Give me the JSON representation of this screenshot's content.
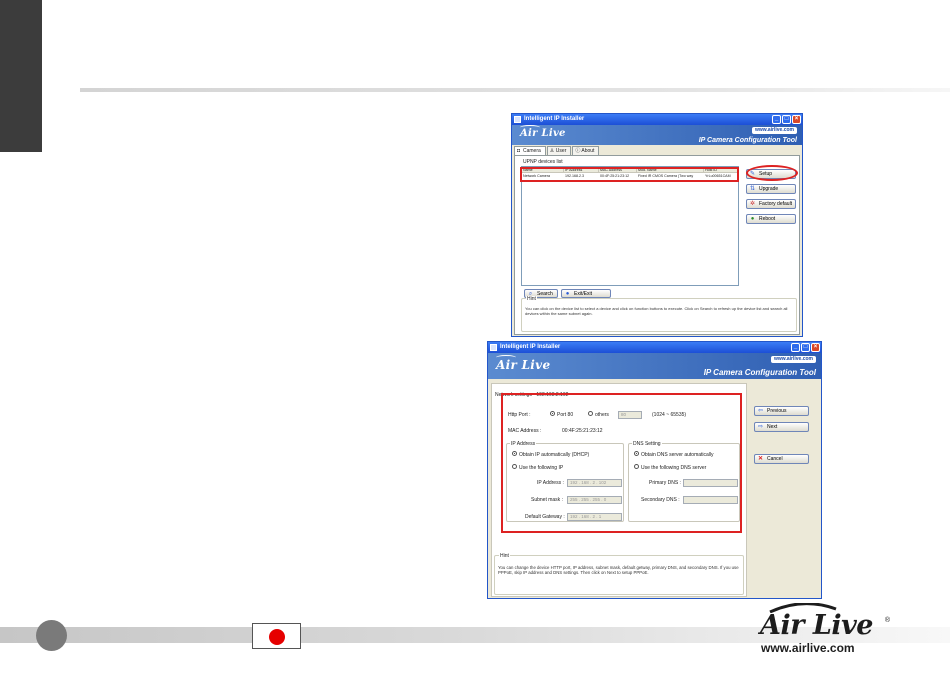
{
  "window1": {
    "title": "Intelligent IP Installer",
    "banner": {
      "logo": "Air Live",
      "url": "www.airlive.com",
      "subtitle": "IP Camera Configuration Tool"
    },
    "tabs": [
      {
        "label": "Camera",
        "icon": "camera-icon"
      },
      {
        "label": "User",
        "icon": "user-icon"
      },
      {
        "label": "About",
        "icon": "info-icon"
      }
    ],
    "devices_label": "UPNP devices list",
    "columns": [
      "Name",
      "IP Address",
      "MAC Address",
      "Mod. Name",
      "Host ID"
    ],
    "rows": [
      [
        "Network Camera",
        "192.168.2.3",
        "00:4F:25:21:23:12",
        "Fixed IR CMOS Camera (Two way",
        "YrLu00651CAM"
      ]
    ],
    "buttons": {
      "setup": "Setup",
      "upgrade": "Upgrade",
      "factory_default": "Factory default",
      "reboot": "Reboot",
      "search": "Search",
      "exit": "Exit/Exit"
    },
    "hint_label": "Hint",
    "hint_text": "You can click on the device list to select a device and click on function buttons to execute. Click on Search to refresh up the device list and search all devices  within the same subnet again."
  },
  "window2": {
    "title": "Intelligent IP Installer",
    "banner": {
      "logo": "Air Live",
      "url": "www.airlive.com",
      "subtitle": "IP Camera Configuration Tool"
    },
    "network_settings": "Network settings - 192.168.2.102",
    "http_port_label": "Http Port :",
    "port80_label": "Port 80",
    "others_label": "others",
    "others_value": "80",
    "port_range": "(1024 ~ 65535)",
    "mac_label": "MAC Address :",
    "mac_value": "00:4F:25:21:23:12",
    "ip_group": "IP Address",
    "dhcp_label": "Obtain IP automatically (DHCP)",
    "use_ip_label": "Use the following IP",
    "ip_address_label": "IP Address :",
    "ip_address_value": "192 . 168 .   2 . 102",
    "subnet_label": "Subnet mask :",
    "subnet_value": "255 . 255 . 255 .   0",
    "gateway_label": "Default Gateway :",
    "gateway_value": "192 . 168 .   2 .   1",
    "dns_group": "DNS Setting",
    "dns_auto_label": "Obtain DNS server automatically",
    "dns_use_label": "Use the following DNS server",
    "primary_dns_label": "Primary DNS :",
    "secondary_dns_label": "Secondary DNS :",
    "buttons": {
      "previous": "Previous",
      "next": "Next",
      "cancel": "Cancel"
    },
    "hint_label": "Hint",
    "hint_text": "You can change the device HTTP port, IP address, subnet mask, default getway, primary DNS, and secondary DNS. If you use PPPoE, skip IP address and DNS settings. Then click on Next to setup PPPoE."
  },
  "footer": {
    "brand": "Air Live",
    "url": "www.airlive.com",
    "flag_color": "#e60000"
  }
}
